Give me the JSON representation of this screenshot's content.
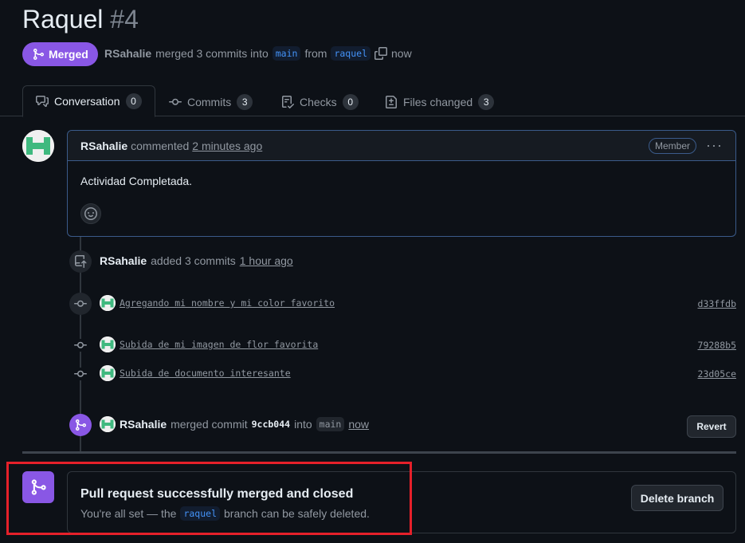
{
  "header": {
    "title": "Raquel",
    "number": "#4",
    "status": "Merged",
    "author": "RSahalie",
    "merged_text": "merged 3 commits into",
    "base_branch": "main",
    "from_text": "from",
    "head_branch": "raquel",
    "time": "now"
  },
  "tabs": [
    {
      "label": "Conversation",
      "count": "0",
      "icon": "comment-discussion-icon"
    },
    {
      "label": "Commits",
      "count": "3",
      "icon": "git-commit-icon"
    },
    {
      "label": "Checks",
      "count": "0",
      "icon": "checklist-icon"
    },
    {
      "label": "Files changed",
      "count": "3",
      "icon": "file-diff-icon"
    }
  ],
  "comment": {
    "author": "RSahalie",
    "action": "commented",
    "time": "2 minutes ago",
    "role": "Member",
    "body": "Actividad Completada."
  },
  "timeline": {
    "added": {
      "author": "RSahalie",
      "action": "added 3 commits",
      "time": "1 hour ago"
    },
    "commits": [
      {
        "message": "Agregando mi nombre y mi color favorito",
        "sha": "d33ffdb"
      },
      {
        "message": "Subida de mi imagen de flor favorita",
        "sha": "79288b5"
      },
      {
        "message": "Subida de documento interesante",
        "sha": "23d05ce"
      }
    ],
    "merged": {
      "author": "RSahalie",
      "action": "merged commit",
      "sha": "9ccb044",
      "into": "into",
      "branch": "main",
      "time": "now",
      "revert_label": "Revert"
    }
  },
  "merge_box": {
    "title": "Pull request successfully merged and closed",
    "sub_prefix": "You're all set — the",
    "branch": "raquel",
    "sub_suffix": "branch can be safely deleted.",
    "delete_label": "Delete branch"
  },
  "colors": {
    "background": "#0d1117",
    "merged_purple": "#8957e5",
    "link_blue": "#4493f8",
    "highlight_red": "#e5202a"
  }
}
